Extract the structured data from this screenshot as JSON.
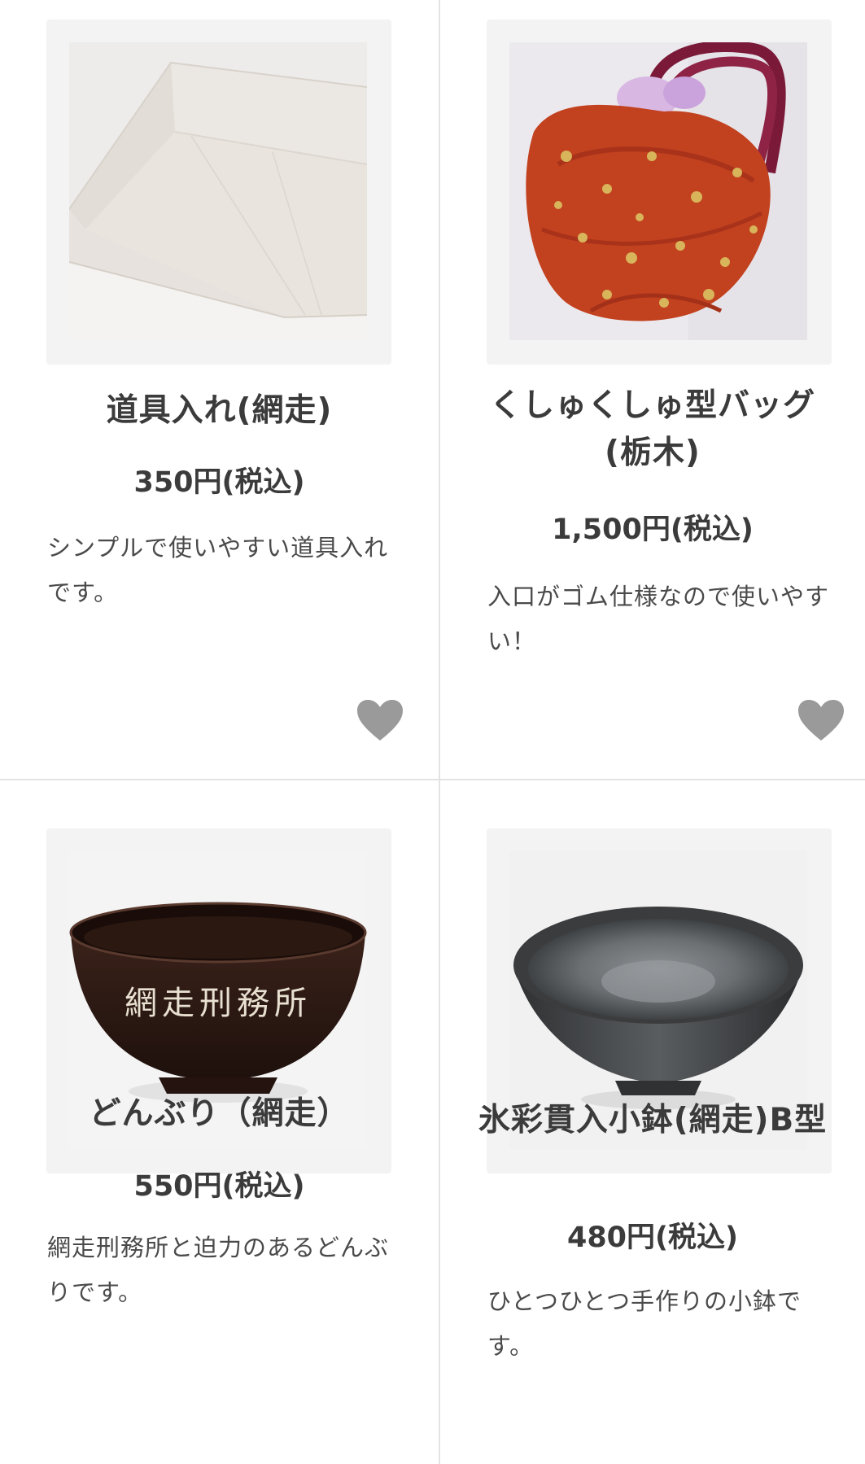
{
  "products": [
    {
      "title": "道具入れ(網走)",
      "price": "350円(税込)",
      "description": "シンプルで使いやすい道具入れです。",
      "favorite_icon": "heart-icon"
    },
    {
      "title": "くしゅくしゅ型バッグ(栃木)",
      "price": "1,500円(税込)",
      "description": "入口がゴム仕様なので使いやすい！",
      "favorite_icon": "heart-icon"
    },
    {
      "title": "どんぶり（網走）",
      "price": "550円(税込)",
      "description": "網走刑務所と迫力のあるどんぶりです。",
      "bowl_inscription": "網走刑務所"
    },
    {
      "title": "氷彩貫入小鉢(網走)B型",
      "price": "480円(税込)",
      "description": "ひとつひとつ手作りの小鉢です。"
    }
  ],
  "colors": {
    "background": "#ffffff",
    "divider": "#e3e3e3",
    "thumb_frame": "#f3f3f3",
    "text": "#3b3b3b",
    "heart": "#9a9a9a",
    "bag_red": "#c2411f",
    "bowl_dark": "#2a1812"
  }
}
